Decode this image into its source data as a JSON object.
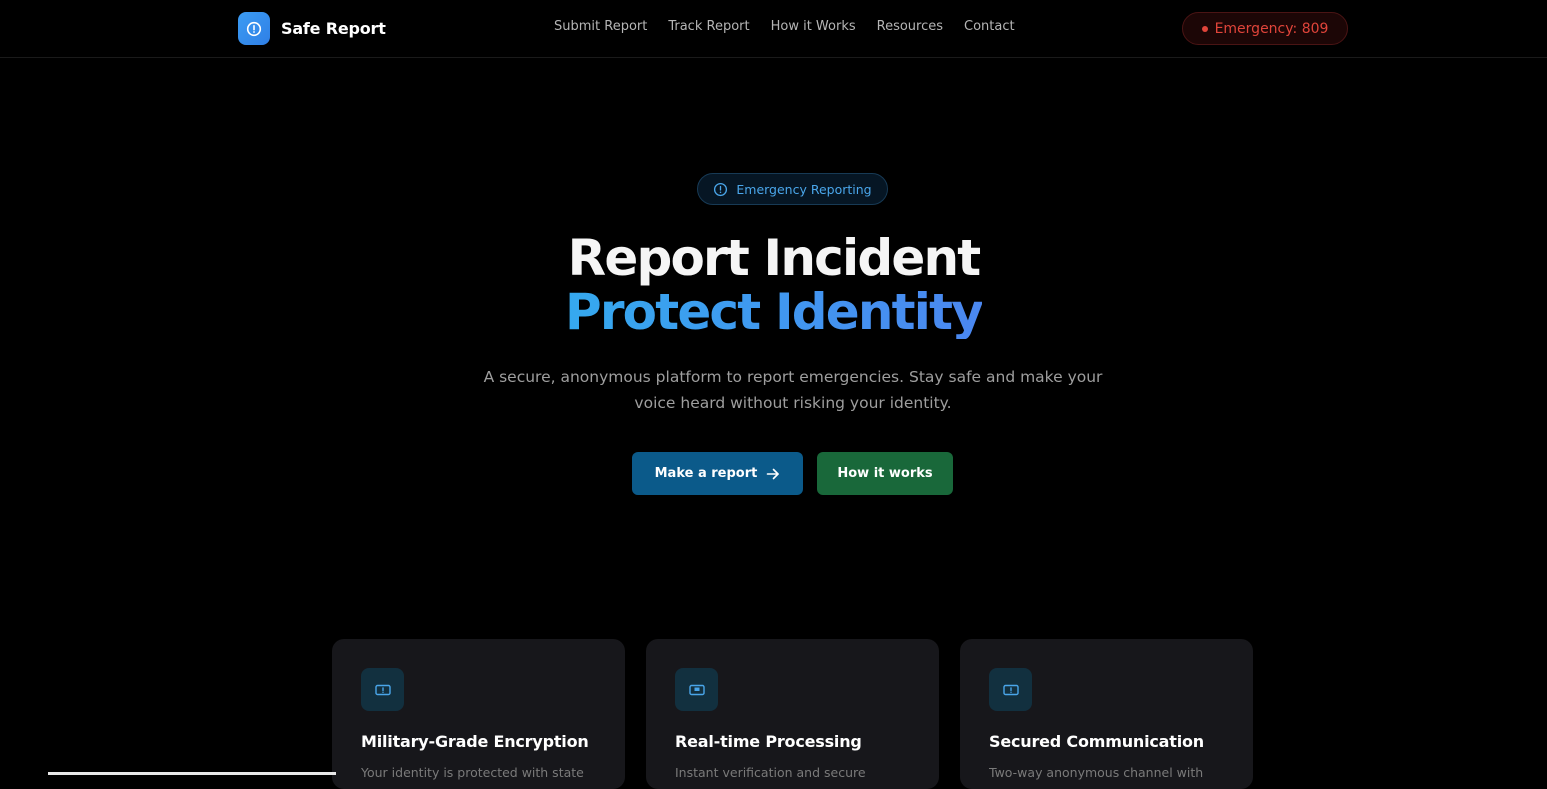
{
  "header": {
    "brand_name": "Safe Report",
    "nav": [
      "Submit Report",
      "Track Report",
      "How it Works",
      "Resources",
      "Contact"
    ],
    "emergency_label": "Emergency: 809"
  },
  "hero": {
    "badge": "Emergency Reporting",
    "title_line1": "Report Incident",
    "title_line2": "Protect Identity",
    "subtitle": "A secure, anonymous platform to report emergencies. Stay safe and make your voice heard without risking your identity.",
    "primary_button": "Make a report",
    "secondary_button": "How it works"
  },
  "features": [
    {
      "title": "Military-Grade Encryption",
      "description": "Your identity is protected with state",
      "icon": "alert-card-icon"
    },
    {
      "title": "Real-time Processing",
      "description": "Instant verification and secure",
      "icon": "monitor-icon"
    },
    {
      "title": "Secured Communication",
      "description": "Two-way anonymous channel with",
      "icon": "alert-card-icon"
    }
  ],
  "colors": {
    "background": "#000000",
    "accent_blue": "#3b9cf3",
    "emergency_red": "#e0443a",
    "primary_button": "#0b5a8a",
    "secondary_button": "#19683a"
  }
}
